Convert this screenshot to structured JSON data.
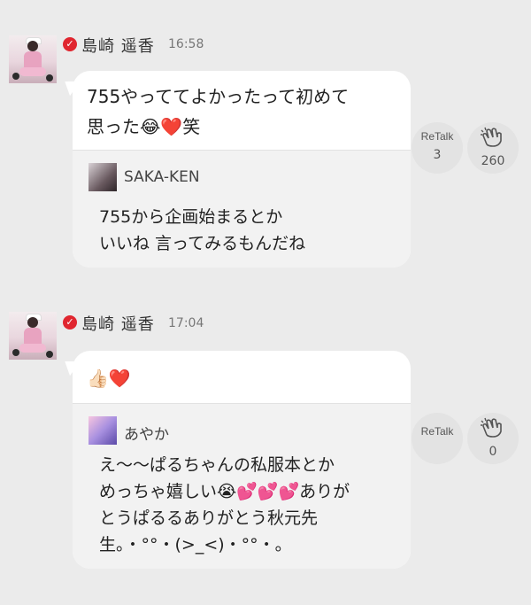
{
  "posts": [
    {
      "author": "島崎 遥香",
      "time": "16:58",
      "message": "755やっててよかったって初めて\n思った😂❤️笑",
      "quote": {
        "author": "SAKA-KEN",
        "text": "755から企画始まるとか\nいいね 言ってみるもんだね"
      },
      "retalk": {
        "label": "ReTalk",
        "count": "3"
      },
      "applause": {
        "count": "260"
      }
    },
    {
      "author": "島崎 遥香",
      "time": "17:04",
      "message": "👍🏻❤️",
      "quote": {
        "author": "あやか",
        "text": "え〜〜ぱるちゃんの私服本とか\nめっちゃ嬉しい😭💕💕💕ありが\nとうぱるるありがとう秋元先\n生。・°°・(>_<)・°°・。"
      },
      "retalk": {
        "label": "ReTalk",
        "count": ""
      },
      "applause": {
        "count": "0"
      }
    }
  ],
  "icons": {
    "verified": "verified-check-icon",
    "applause": "clap-icon"
  },
  "colors": {
    "background": "#ebebeb",
    "verified": "#e0262f",
    "bubble": "#ffffff",
    "quote": "#f2f2f2"
  }
}
